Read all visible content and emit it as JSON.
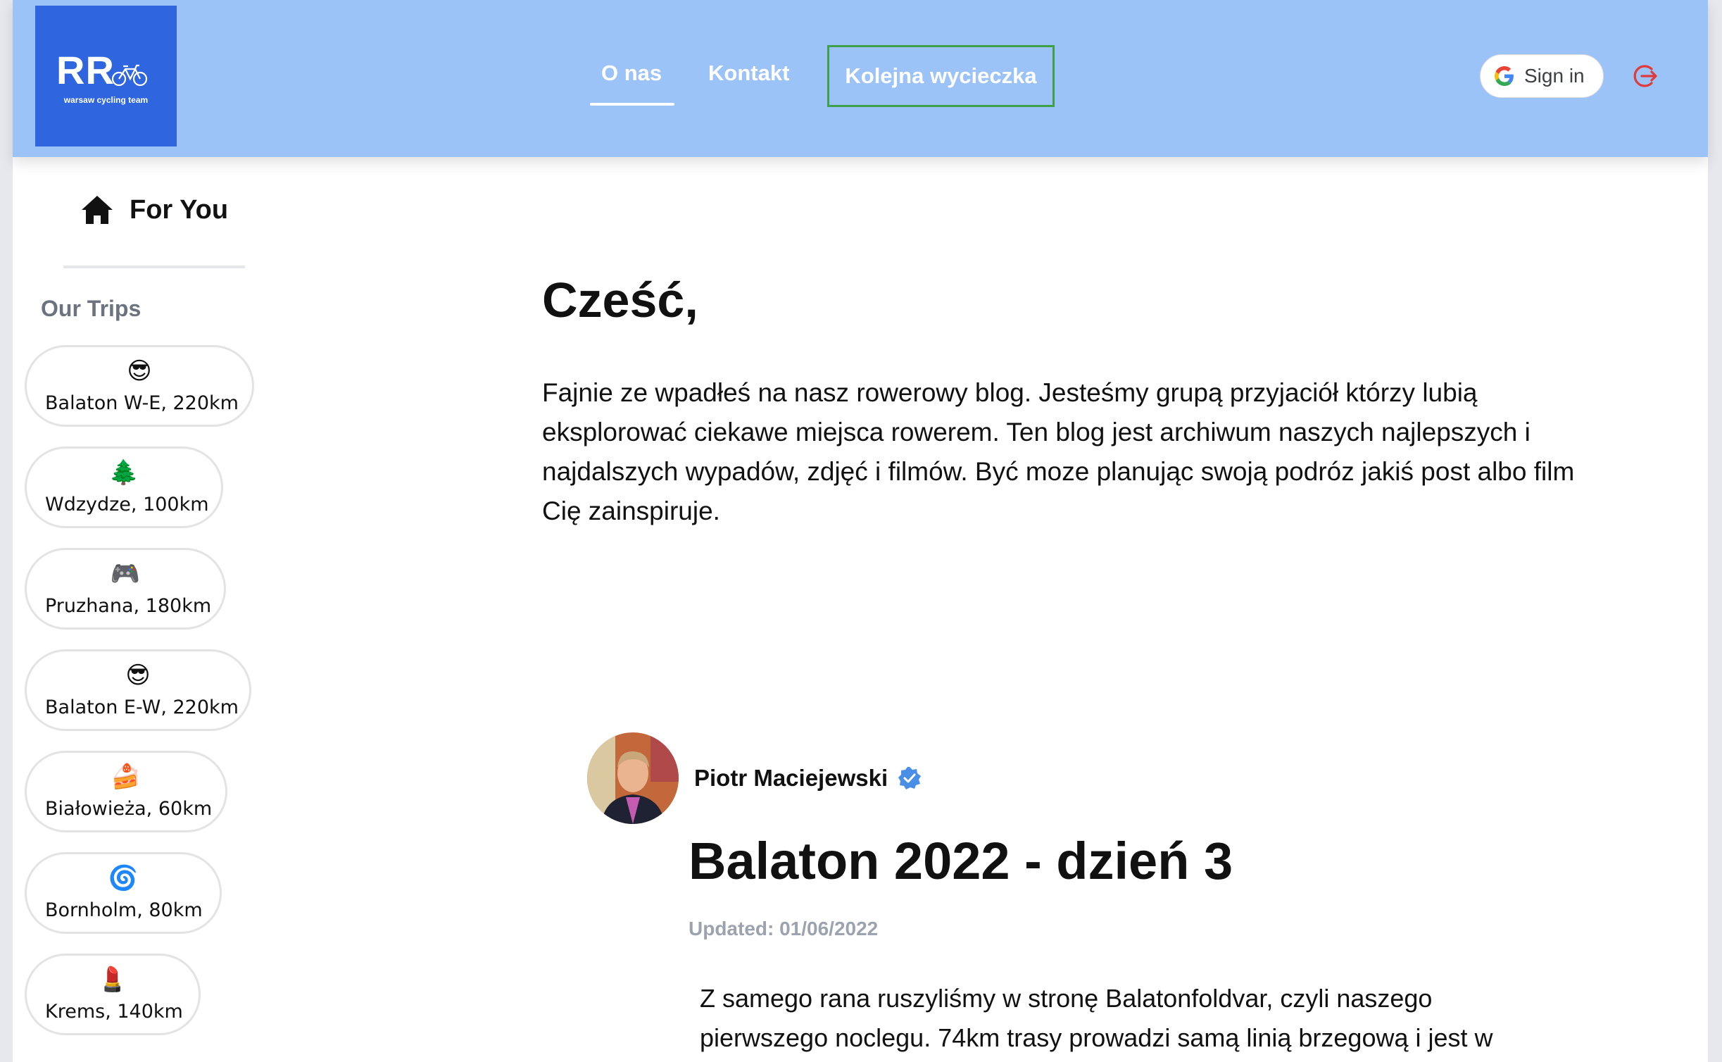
{
  "header": {
    "logo": {
      "initials": "RR",
      "subtitle": "warsaw cycling team",
      "icon": "bicycle-icon"
    },
    "nav": [
      {
        "label": "O nas",
        "active": true
      },
      {
        "label": "Kontakt",
        "active": false
      },
      {
        "label": "Kolejna wycieczka",
        "highlighted": true
      }
    ],
    "signin_label": "Sign in",
    "signin_icon": "google-icon",
    "logout_icon": "logout-icon",
    "colors": {
      "header_bg": "#9cc3f8",
      "logo_bg": "#2f66e0",
      "highlight_border": "#3ea14a",
      "logout": "#e03a3a"
    }
  },
  "sidebar": {
    "for_you": {
      "label": "For You",
      "icon": "home-icon"
    },
    "section_title": "Our Trips",
    "trips": [
      {
        "label": "Balaton W-E, 220km",
        "icon": "sunglasses-face-icon"
      },
      {
        "label": "Wdzydze, 100km",
        "icon": "forest-icon"
      },
      {
        "label": "Pruzhana, 180km",
        "icon": "gamepad-icon"
      },
      {
        "label": "Balaton E-W, 220km",
        "icon": "sunglasses-face-icon"
      },
      {
        "label": "Białowieża, 60km",
        "icon": "cake-icon"
      },
      {
        "label": "Bornholm, 80km",
        "icon": "swirl-icon"
      },
      {
        "label": "Krems, 140km",
        "icon": "lipstick-icon"
      }
    ]
  },
  "main": {
    "greeting": "Cześć,",
    "intro": "Fajnie ze wpadłeś na nasz rowerowy blog. Jesteśmy grupą przyjaciół którzy lubią eksplorować ciekawe miejsca rowerem. Ten blog jest archiwum naszych najlepszych i najdalszych wypadów, zdjęć i filmów. Być moze planując swoją podróz jakiś post albo film Cię zainspiruje.",
    "post": {
      "author": "Piotr Maciejewski",
      "verified_icon": "verified-badge-icon",
      "title": "Balaton 2022 - dzień 3",
      "updated": "Updated: 01/06/2022",
      "body": "Z samego rana ruszyliśmy w stronę Balatonfoldvar, czyli naszego pierwszego noclegu. 74km trasy prowadzi samą linią brzegową i jest w"
    }
  }
}
